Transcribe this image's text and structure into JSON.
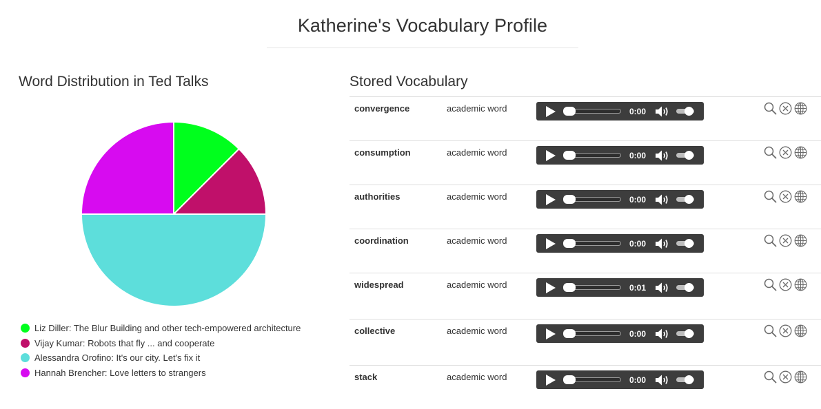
{
  "page": {
    "title": "Katherine's Vocabulary Profile"
  },
  "chart_section": {
    "heading": "Word Distribution in Ted Talks"
  },
  "vocab_section": {
    "heading": "Stored Vocabulary"
  },
  "chart_data": {
    "type": "pie",
    "title": "",
    "slices": [
      {
        "label": "Liz Diller: The Blur Building and other tech-empowered architecture",
        "value": 1,
        "color": "#00ff1d"
      },
      {
        "label": "Vijay Kumar: Robots that fly ... and cooperate",
        "value": 1,
        "color": "#c0106a"
      },
      {
        "label": "Alessandra Orofino: It's our city. Let's fix it",
        "value": 4,
        "color": "#5ddedb"
      },
      {
        "label": "Hannah Brencher: Love letters to strangers",
        "value": 2,
        "color": "#d70bf0"
      }
    ],
    "legend_position": "bottom-left"
  },
  "vocabulary": [
    {
      "word": "convergence",
      "category": "academic word",
      "time": "0:00"
    },
    {
      "word": "consumption",
      "category": "academic word",
      "time": "0:00"
    },
    {
      "word": "authorities",
      "category": "academic word",
      "time": "0:00"
    },
    {
      "word": "coordination",
      "category": "academic word",
      "time": "0:00"
    },
    {
      "word": "widespread",
      "category": "academic word",
      "time": "0:01"
    },
    {
      "word": "collective",
      "category": "academic word",
      "time": "0:00"
    },
    {
      "word": "stack",
      "category": "academic word",
      "time": "0:00"
    }
  ],
  "icons": {
    "play": "play-icon",
    "volume": "volume-icon",
    "lookup": "search-icon",
    "delete": "close-circle-icon",
    "web": "globe-icon"
  }
}
